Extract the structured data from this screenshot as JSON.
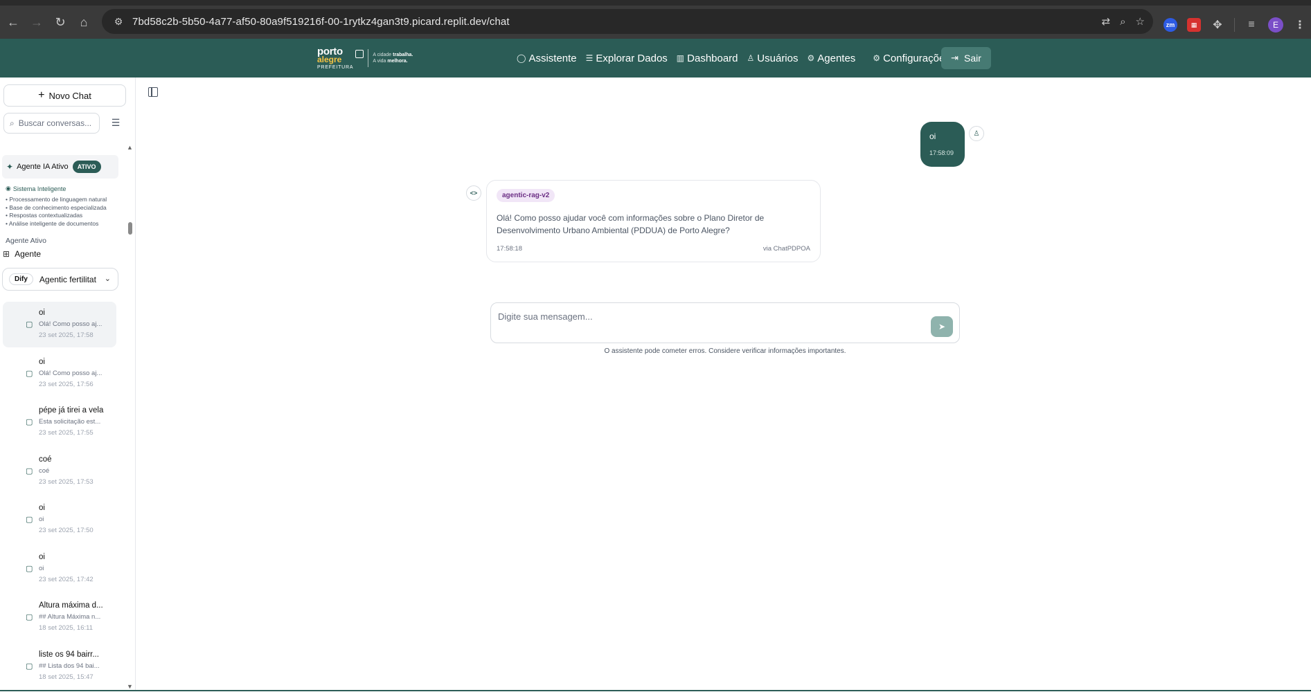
{
  "browser": {
    "url": "7bd58c2b-5b50-4a77-af50-80a9f519216f-00-1rytkz4gan3t9.picard.replit.dev/chat",
    "profile_initial": "E",
    "extensions": [
      "zm"
    ]
  },
  "header": {
    "logo": {
      "line1": "porto",
      "line2": "alegre",
      "line3": "PREFEITURA",
      "slogan_a": "A cidade",
      "slogan_b": "trabalha.",
      "slogan_c": "A vida",
      "slogan_d": "melhora."
    },
    "nav": [
      {
        "label": "Assistente",
        "icon": "chat-icon"
      },
      {
        "label": "Explorar Dados",
        "icon": "database-icon"
      },
      {
        "label": "Dashboard",
        "icon": "bar-chart-icon"
      },
      {
        "label": "Usuários",
        "icon": "users-icon"
      },
      {
        "label": "Agentes",
        "icon": "gear-icon"
      },
      {
        "label": "Configurações",
        "icon": "settings-icon"
      }
    ],
    "logout_label": "Sair"
  },
  "sidebar": {
    "new_chat_label": "Novo Chat",
    "search_placeholder": "Buscar conversas...",
    "agent_active": {
      "label": "Agente IA Ativo",
      "badge": "ATIVO"
    },
    "system": {
      "title": "Sistema Inteligente",
      "features": [
        "• Processamento de linguagem natural",
        "• Base de conhecimento especializada",
        "• Respostas contextualizadas",
        "• Análise inteligente de documentos"
      ]
    },
    "agent_section_label": "Agente Ativo",
    "agent_label": "Agente",
    "agent_select": {
      "provider": "Dify",
      "value": "Agentic fertilitat"
    },
    "conversations": [
      {
        "title": "oi",
        "preview": "Olá! Como posso aj...",
        "date": "23 set 2025, 17:58"
      },
      {
        "title": "oi",
        "preview": "Olá! Como posso aj...",
        "date": "23 set 2025, 17:56"
      },
      {
        "title": "pépe já tirei a vela",
        "preview": "Esta solicitação est...",
        "date": "23 set 2025, 17:55"
      },
      {
        "title": "coé",
        "preview": "coé",
        "date": "23 set 2025, 17:53"
      },
      {
        "title": "oi",
        "preview": "oi",
        "date": "23 set 2025, 17:50"
      },
      {
        "title": "oi",
        "preview": "oi",
        "date": "23 set 2025, 17:42"
      },
      {
        "title": "Altura máxima d...",
        "preview": "## Altura Máxima n...",
        "date": "18 set 2025, 16:11"
      },
      {
        "title": "liste os 94 bairr...",
        "preview": "## Lista dos 94 bai...",
        "date": "18 set 2025, 15:47"
      }
    ]
  },
  "chat": {
    "user_message": {
      "text": "oi",
      "time": "17:58:09"
    },
    "bot_message": {
      "tag": "agentic-rag-v2",
      "text": "Olá! Como posso ajudar você com informações sobre o Plano Diretor de Desenvolvimento Urbano Ambiental (PDDUA) de Porto Alegre?",
      "time": "17:58:18",
      "via": "via ChatPDPOA"
    },
    "composer_placeholder": "Digite sua mensagem...",
    "disclaimer": "O assistente pode cometer erros. Considere verificar informações importantes."
  }
}
